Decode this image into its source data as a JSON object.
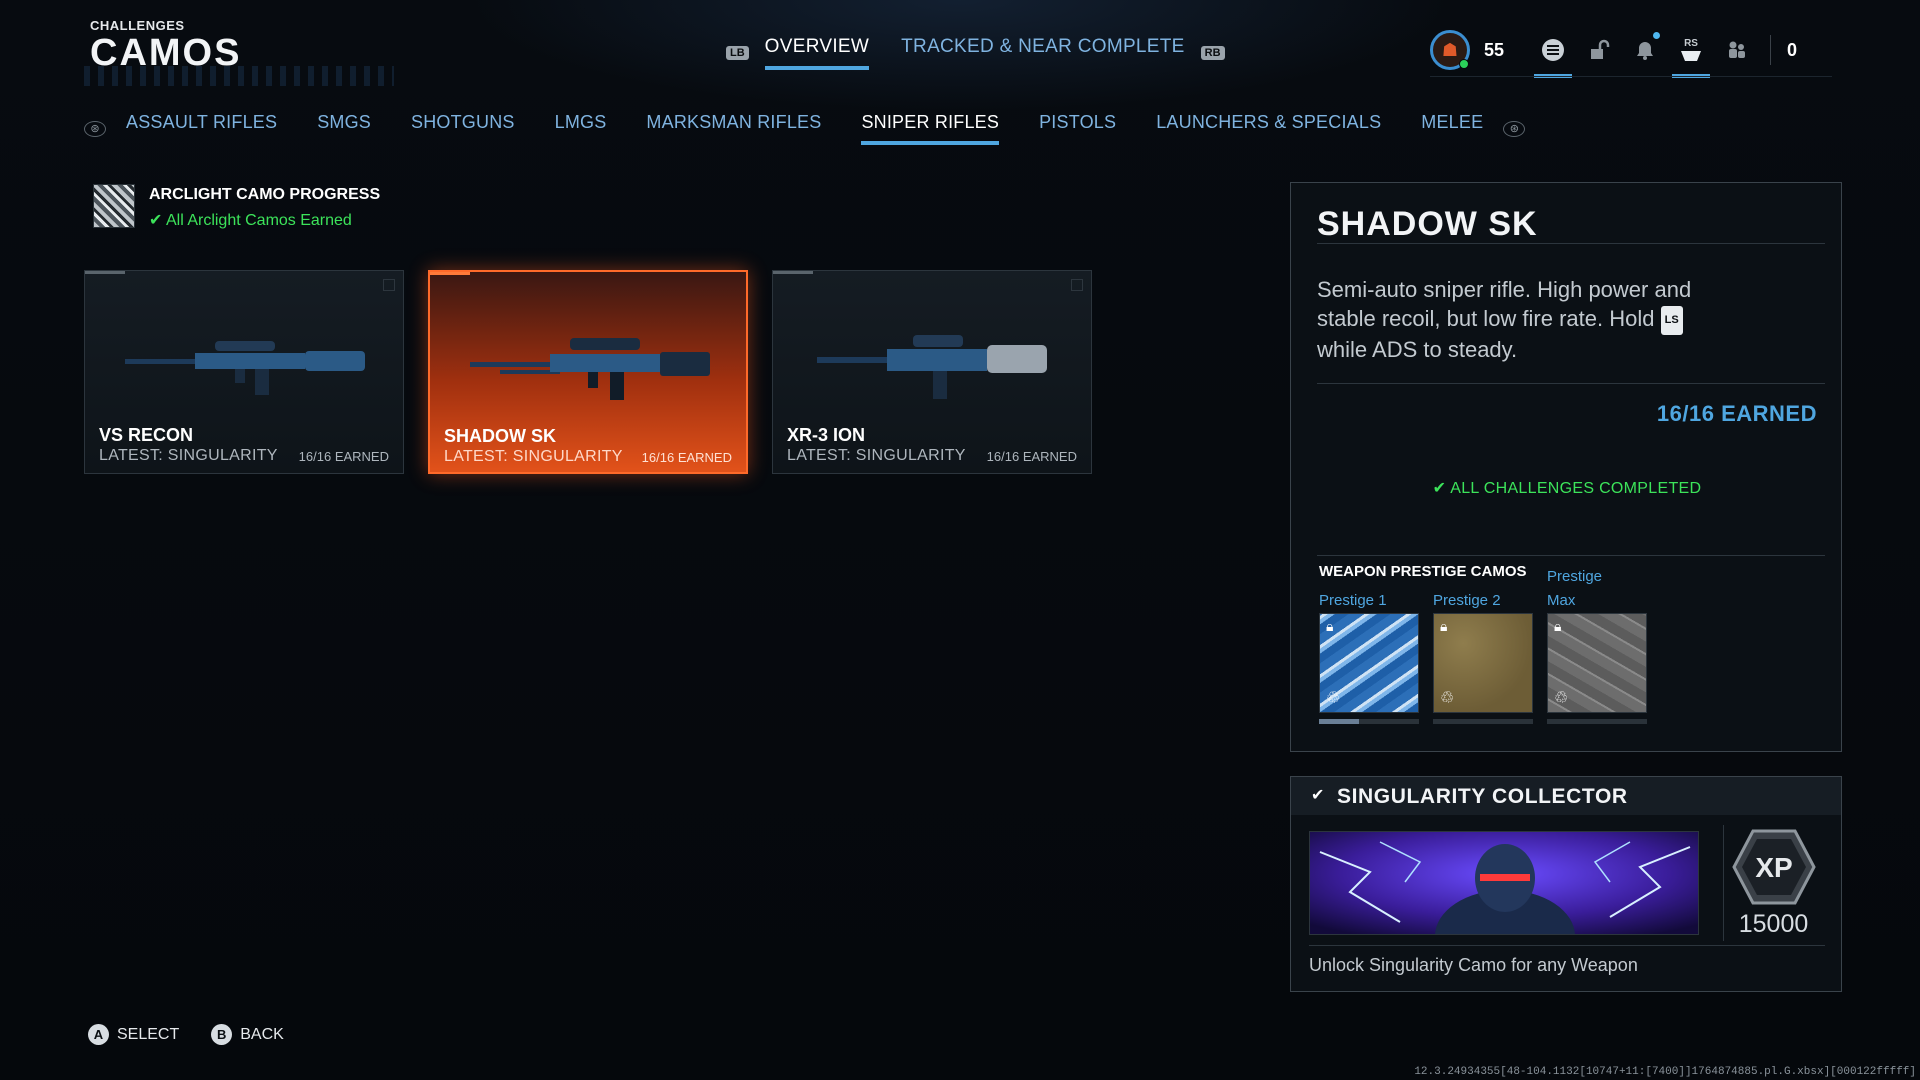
{
  "header": {
    "kicker": "CHALLENGES",
    "title": "CAMOS",
    "left_bumper": "LB",
    "right_bumper": "RB",
    "tabs": [
      {
        "label": "OVERVIEW",
        "active": true
      },
      {
        "label": "TRACKED & NEAR COMPLETE",
        "active": false
      }
    ]
  },
  "player": {
    "level": "55",
    "currency": "0",
    "rs_label": "RS",
    "icons": [
      "avatar-icon",
      "menu-icon",
      "unlock-icon",
      "bell-icon",
      "controller-icon",
      "friends-icon"
    ]
  },
  "categories": {
    "left_bumper": "⊛",
    "right_bumper": "⊛",
    "tabs": [
      {
        "label": "ASSAULT RIFLES",
        "active": false
      },
      {
        "label": "SMGS",
        "active": false
      },
      {
        "label": "SHOTGUNS",
        "active": false
      },
      {
        "label": "LMGS",
        "active": false
      },
      {
        "label": "MARKSMAN RIFLES",
        "active": false
      },
      {
        "label": "SNIPER RIFLES",
        "active": true
      },
      {
        "label": "PISTOLS",
        "active": false
      },
      {
        "label": "LAUNCHERS & SPECIALS",
        "active": false
      },
      {
        "label": "MELEE",
        "active": false
      }
    ]
  },
  "arclight": {
    "title": "ARCLIGHT CAMO PROGRESS",
    "status": "All Arclight Camos Earned"
  },
  "weapons": [
    {
      "name": "VS RECON",
      "latest": "LATEST: SINGULARITY",
      "earned": "16/16 EARNED",
      "selected": false
    },
    {
      "name": "SHADOW SK",
      "latest": "LATEST: SINGULARITY",
      "earned": "16/16 EARNED",
      "selected": true
    },
    {
      "name": "XR-3 ION",
      "latest": "LATEST: SINGULARITY",
      "earned": "16/16 EARNED",
      "selected": false
    }
  ],
  "detail": {
    "title": "SHADOW SK",
    "desc_part1": "Semi-auto sniper rifle. High power and stable recoil, but low fire rate. Hold",
    "desc_button": "LS",
    "desc_part2": "while ADS to steady.",
    "earned": "16/16 EARNED",
    "complete": "ALL CHALLENGES COMPLETED",
    "prestige_heading": "WEAPON PRESTIGE CAMOS",
    "prestige": [
      {
        "label": "Prestige 1",
        "progress": 0.4
      },
      {
        "label": "Prestige 2",
        "progress": 0
      },
      {
        "label": "Prestige Max",
        "progress": 0
      }
    ]
  },
  "reward": {
    "title": "SINGULARITY COLLECTOR",
    "xp_label": "XP",
    "xp_amount": "15000",
    "desc": "Unlock Singularity Camo for any Weapon"
  },
  "footer": {
    "select_glyph": "A",
    "select_label": "SELECT",
    "back_glyph": "B",
    "back_label": "BACK"
  },
  "build_info": "12.3.24934355[48-104.1132[10747+11:[7400]]1764874885.pl.G.xbsx][000122fffff]",
  "colors": {
    "accent": "#4fa6e0",
    "selected_card": "#e2521a",
    "success": "#3ce35a"
  }
}
